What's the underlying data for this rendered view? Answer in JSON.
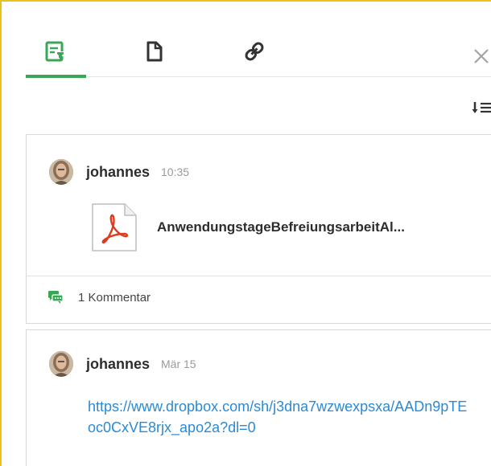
{
  "icons": {
    "notes_tab": "notes-pin-icon",
    "files_tab": "file-icon",
    "links_tab": "link-icon",
    "close": "close-icon",
    "sort": "sort-icon",
    "avatar": "user-avatar",
    "pdf": "pdf-file-icon",
    "comments": "comments-icon"
  },
  "colors": {
    "accent_green": "#3aa757",
    "frame_yellow": "#e8c21a",
    "link_blue": "#2b8ad4"
  },
  "posts": [
    {
      "author": "johannes",
      "time": "10:35",
      "attachment": {
        "type": "pdf",
        "name": "AnwendungstageBefreiungsarbeitAl..."
      },
      "comments_label": "1 Kommentar"
    },
    {
      "author": "johannes",
      "time": "Mär 15",
      "link_text": "https://www.dropbox.com/sh/j3dna7wzwexpsxa/AADn9pTEoc0CxVE8rjx_apo2a?dl=0"
    }
  ]
}
